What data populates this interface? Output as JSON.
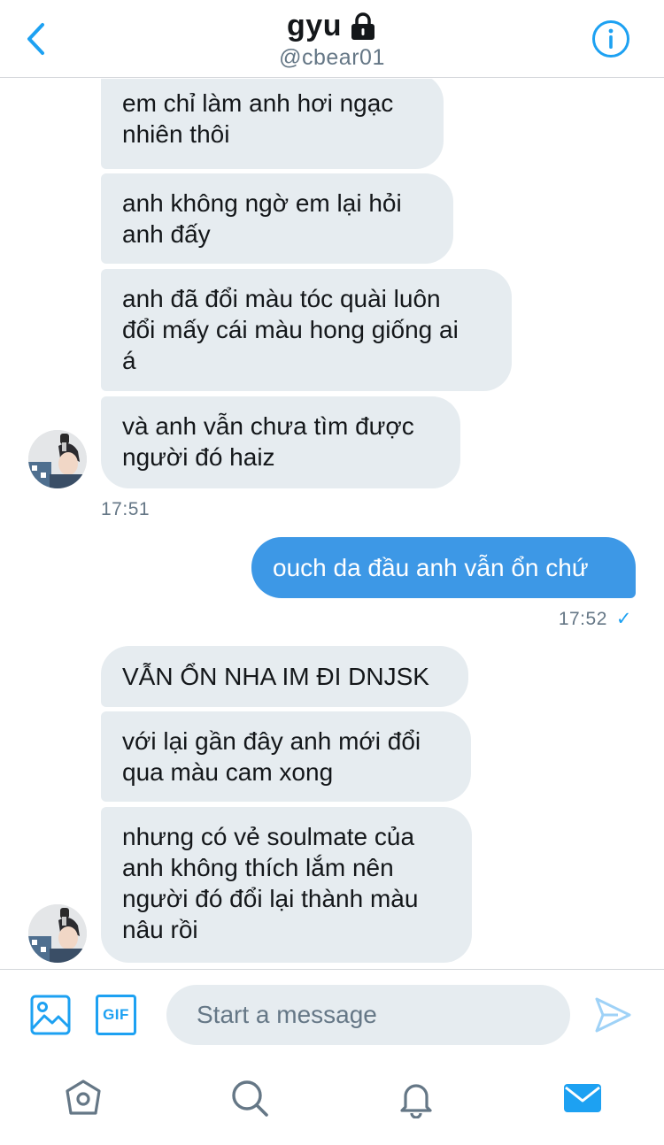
{
  "header": {
    "title": "gyu",
    "handle": "@cbear01",
    "icons": [
      "back-arrow-icon",
      "lock-icon",
      "info-icon"
    ]
  },
  "messages": {
    "group1": [
      "em chỉ làm anh hơi ngạc",
      "nhiên thôi",
      "anh không ngờ em lại hỏi",
      "anh đấy",
      "anh đã đổi màu tóc quài luôn",
      "đổi mấy cái màu hong giống ai",
      "á",
      "và anh vẫn chưa tìm được",
      "người đó haiz"
    ],
    "group1_time": "17:51",
    "outgoing": "ouch da đầu anh vẫn ổn chứ",
    "outgoing_time": "17:52",
    "outgoing_status": "✓",
    "group2": [
      "VẪN ỔN NHA IM ĐI DNJSK",
      "với lại gần đây anh mới đổi",
      "qua màu cam xong",
      "nhưng có vẻ soulmate của",
      "anh không thích lắm nên",
      "người đó đổi lại thành màu",
      "nâu rồi"
    ]
  },
  "composer": {
    "placeholder": "Start a message",
    "gif_label": "GIF",
    "icons": [
      "image-icon",
      "gif-icon",
      "send-icon"
    ]
  },
  "tabbar": {
    "icons": [
      "home-icon",
      "search-icon",
      "notifications-icon",
      "messages-icon"
    ],
    "active": "messages-icon"
  },
  "colors": {
    "accent": "#1da1f2",
    "outgoing_bubble": "#3d98e6",
    "incoming_bubble": "#e6ecf0",
    "muted_text": "#657786"
  }
}
